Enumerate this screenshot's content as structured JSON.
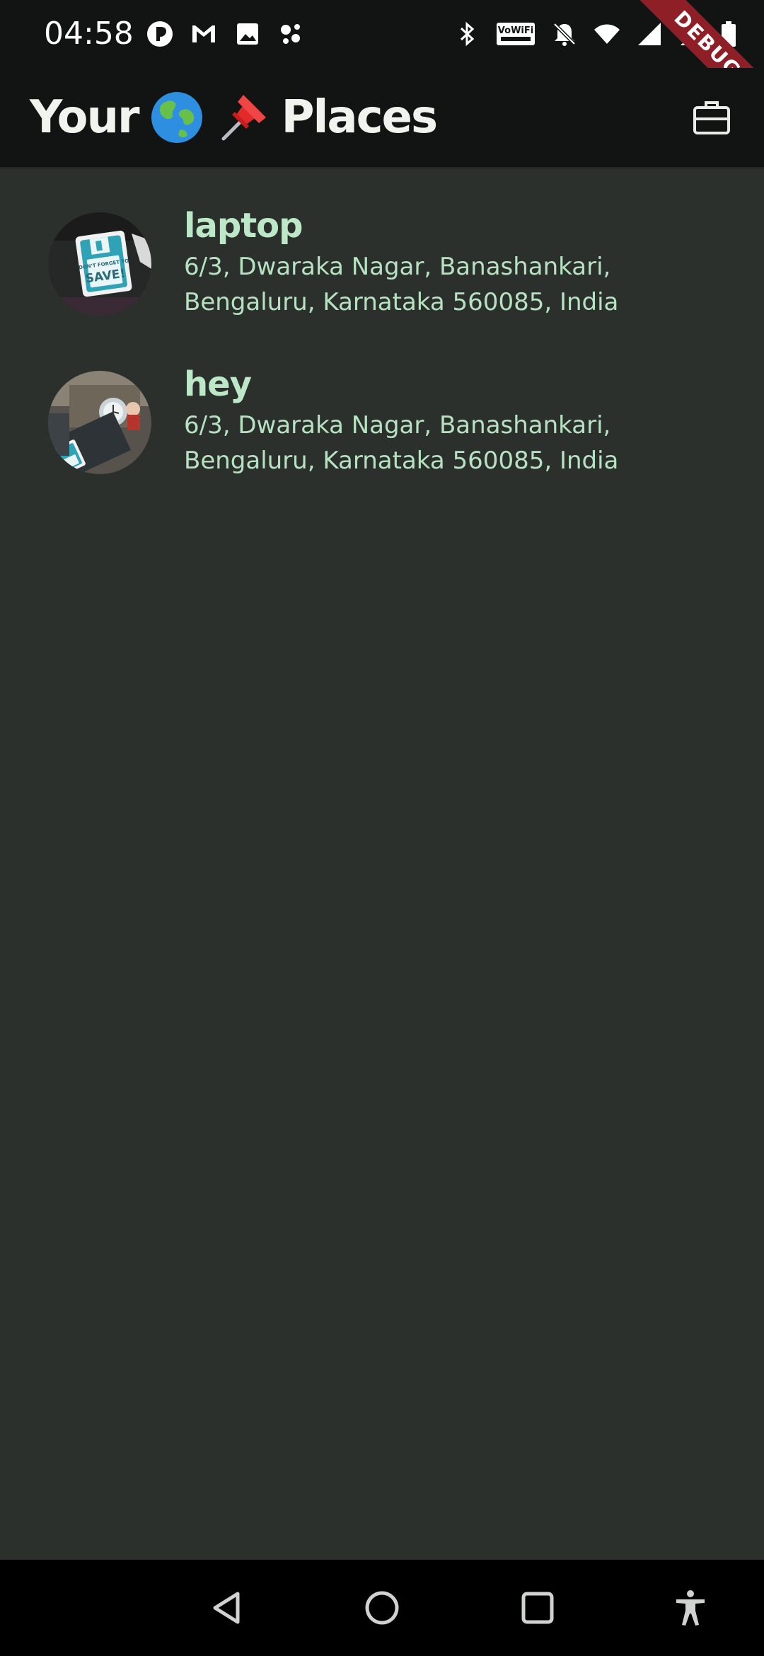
{
  "status_bar": {
    "time": "04:58",
    "left_icons": [
      "tinder-app-icon",
      "gmail-icon",
      "gallery-icon",
      "assistant-icon"
    ],
    "right_icons": [
      "bluetooth-icon",
      "vowifi-icon",
      "bell-off-icon",
      "wifi-icon",
      "signal-icon",
      "signal-roaming-icon",
      "battery-icon"
    ],
    "debug_banner": "DEBUG"
  },
  "app_bar": {
    "title_prefix": "Your",
    "title_suffix": "Places",
    "title_emojis": [
      "globe-icon",
      "pushpin-icon"
    ],
    "action_icon": "briefcase-icon"
  },
  "places": [
    {
      "title": "laptop",
      "address": "6/3, Dwaraka Nagar, Banashankari, Bengaluru, Karnataka 560085, India",
      "sticker_text": "SAVE!"
    },
    {
      "title": "hey",
      "address": "6/3, Dwaraka Nagar, Banashankari, Bengaluru, Karnataka 560085, India"
    }
  ],
  "nav_bar": {
    "buttons": [
      "back-icon",
      "home-icon",
      "recents-icon",
      "accessibility-icon"
    ]
  },
  "colors": {
    "background": "#2c302d",
    "app_bar": "#111412",
    "title_text": "#f1f3ef",
    "list_text": "#bde8c7",
    "debug_ribbon": "#8f1f27"
  }
}
